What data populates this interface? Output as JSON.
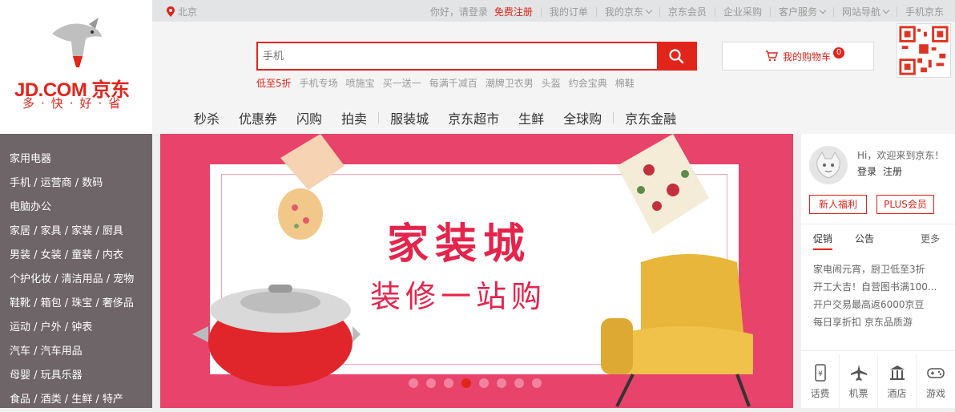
{
  "logo": {
    "brand": "JD.COM 京东",
    "slogan": "多·快·好·省",
    "icon": "jd-dog-mascot-icon"
  },
  "topbar": {
    "location": "北京",
    "greeting": "你好，请登录",
    "register": "免费注册",
    "links": [
      "我的订单",
      "我的京东",
      "京东会员",
      "企业采购",
      "客户服务",
      "网站导航",
      "手机京东"
    ]
  },
  "search": {
    "placeholder": "手机",
    "hot_words": [
      "低至5折",
      "手机专场",
      "喷施宝",
      "买一送一",
      "每满千减百",
      "潮牌卫衣男",
      "头盔",
      "约会宝典",
      "棉鞋"
    ]
  },
  "cart": {
    "label": "我的购物车",
    "count": "0"
  },
  "nav": {
    "items": [
      "秒杀",
      "优惠券",
      "闪购",
      "拍卖",
      "服装城",
      "京东超市",
      "生鲜",
      "全球购",
      "京东金融"
    ]
  },
  "categories": [
    "家用电器",
    "手机 / 运营商 / 数码",
    "电脑办公",
    "家居 / 家具 / 家装 / 厨具",
    "男装 / 女装 / 童装 / 内衣",
    "个护化妆 / 清洁用品 / 宠物",
    "鞋靴 / 箱包 / 珠宝 / 奢侈品",
    "运动 / 户外 / 钟表",
    "汽车 / 汽车用品",
    "母婴 / 玩具乐器",
    "食品 / 酒类 / 生鲜 / 特产"
  ],
  "banner": {
    "title": "家装城",
    "subtitle": "装修一站购",
    "active_slide": 4,
    "slide_count": 8
  },
  "user_panel": {
    "greeting": "Hi，欢迎来到京东！",
    "login": "登录",
    "register": "注册",
    "welfare": "新人福利",
    "plus": "PLUS会员"
  },
  "news": {
    "tab_promo": "促销",
    "tab_notice": "公告",
    "more": "更多",
    "items": [
      "家电闹元宵，厨卫低至3折",
      "开工大吉！自营图书满100...",
      "开户交易最高返6000京豆",
      "每日享折扣 京东品质游"
    ]
  },
  "services": [
    {
      "label": "话费",
      "icon": "phone-bill-icon"
    },
    {
      "label": "机票",
      "icon": "airplane-icon"
    },
    {
      "label": "酒店",
      "icon": "hotel-icon"
    },
    {
      "label": "游戏",
      "icon": "gamepad-icon"
    }
  ],
  "colors": {
    "brand_red": "#e1251b",
    "menu_bg": "#6e6568",
    "banner_pink": "#e8436a"
  }
}
